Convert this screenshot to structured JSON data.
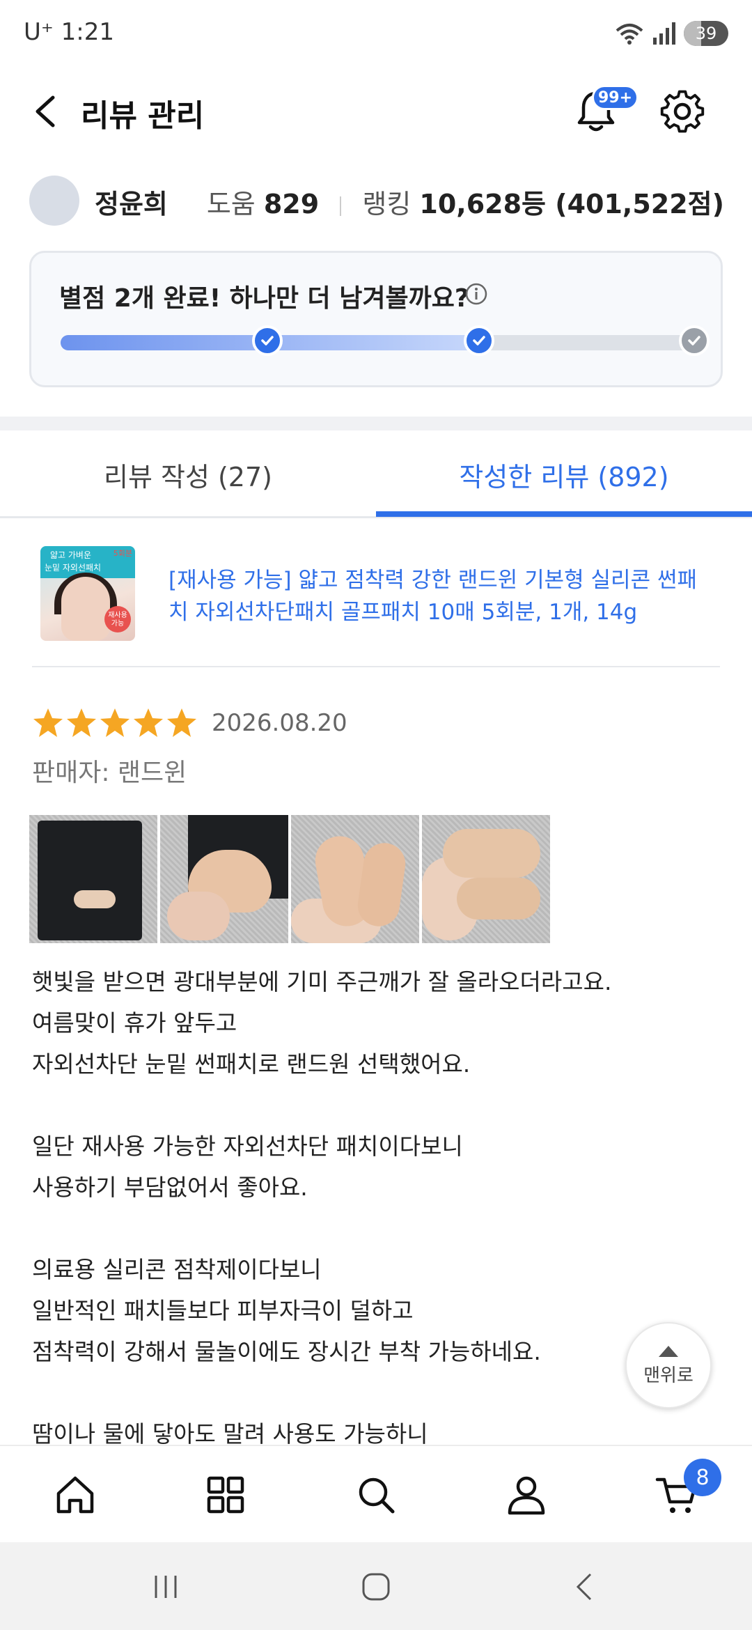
{
  "status_bar": {
    "carrier_time": "U⁺ 1:21",
    "battery": "39",
    "battery_level": 0.39,
    "wifi_label": "5"
  },
  "header": {
    "title": "리뷰 관리",
    "notification_badge": "99+"
  },
  "profile": {
    "name": "정윤희",
    "help_label": "도움",
    "help_value": "829",
    "rank_label": "랭킹",
    "rank_value": "10,628등 (401,522점)"
  },
  "progress": {
    "title": "별점 2개 완료! 하나만 더 남겨볼까요?",
    "completed_steps": 2,
    "total_steps": 3
  },
  "tabs": [
    {
      "label": "리뷰 작성 (27)",
      "active": false
    },
    {
      "label": "작성한 리뷰 (892)",
      "active": true
    }
  ],
  "review": {
    "product_title": "[재사용 가능] 얇고 점착력 강한 랜드윈 기본형 실리콘 썬패치 자외선차단패치 골프패치 10매 5회분, 1개, 14g",
    "product_thumb_text": [
      "얇고 가벼운",
      "눈밑 자외선패치",
      "5회분",
      "재사용 가능"
    ],
    "rating": 5,
    "date": "2026.08.20",
    "seller": "판매자: 랜드윈",
    "photo_count": 4,
    "body_lines": [
      "햇빛을 받으면 광대부분에 기미 주근깨가 잘 올라오더라고요.",
      "여름맞이 휴가 앞두고",
      "자외선차단 눈밑 썬패치로 랜드원 선택했어요.",
      "",
      "일단 재사용 가능한 자외선차단 패치이다보니",
      "사용하기 부담없어서 좋아요.",
      "",
      "의료용 실리콘 점착제이다보니",
      "일반적인 패치들보다 피부자극이 덜하고",
      "점착력이 강해서 물놀이에도 장시간 부착 가능하네요.",
      "",
      "땀이나 물에 닿아도 말려 사용도 가능하니"
    ]
  },
  "scroll_top": {
    "label": "맨위로"
  },
  "bottom_nav": {
    "items": [
      "home-icon",
      "grid-icon",
      "search-icon",
      "person-icon",
      "cart-icon"
    ],
    "cart_badge": "8"
  },
  "colors": {
    "accent": "#2f6fe8",
    "star": "#f5a623",
    "text": "#111111"
  }
}
